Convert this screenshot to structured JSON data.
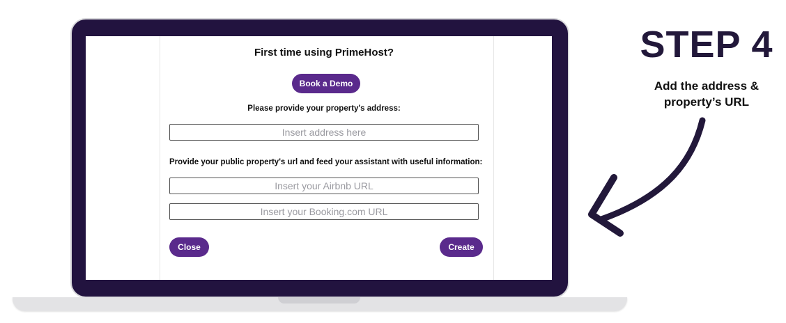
{
  "modal": {
    "title": "First time using PrimeHost?",
    "demo_button": "Book a Demo",
    "address_label": "Please provide your property's address:",
    "address_placeholder": "Insert address here",
    "url_label": "Provide your public property's url and feed your assistant with useful information:",
    "airbnb_placeholder": "Insert your Airbnb URL",
    "booking_placeholder": "Insert your Booking.com URL",
    "close_button": "Close",
    "create_button": "Create"
  },
  "annotation": {
    "step": "STEP 4",
    "description_line1": "Add the address &",
    "description_line2": "property’s URL"
  },
  "colors": {
    "laptop_frame": "#22133f",
    "button_purple": "#5a2a8c",
    "step_title": "#22183a"
  },
  "icons": [
    "curved-arrow-icon"
  ]
}
